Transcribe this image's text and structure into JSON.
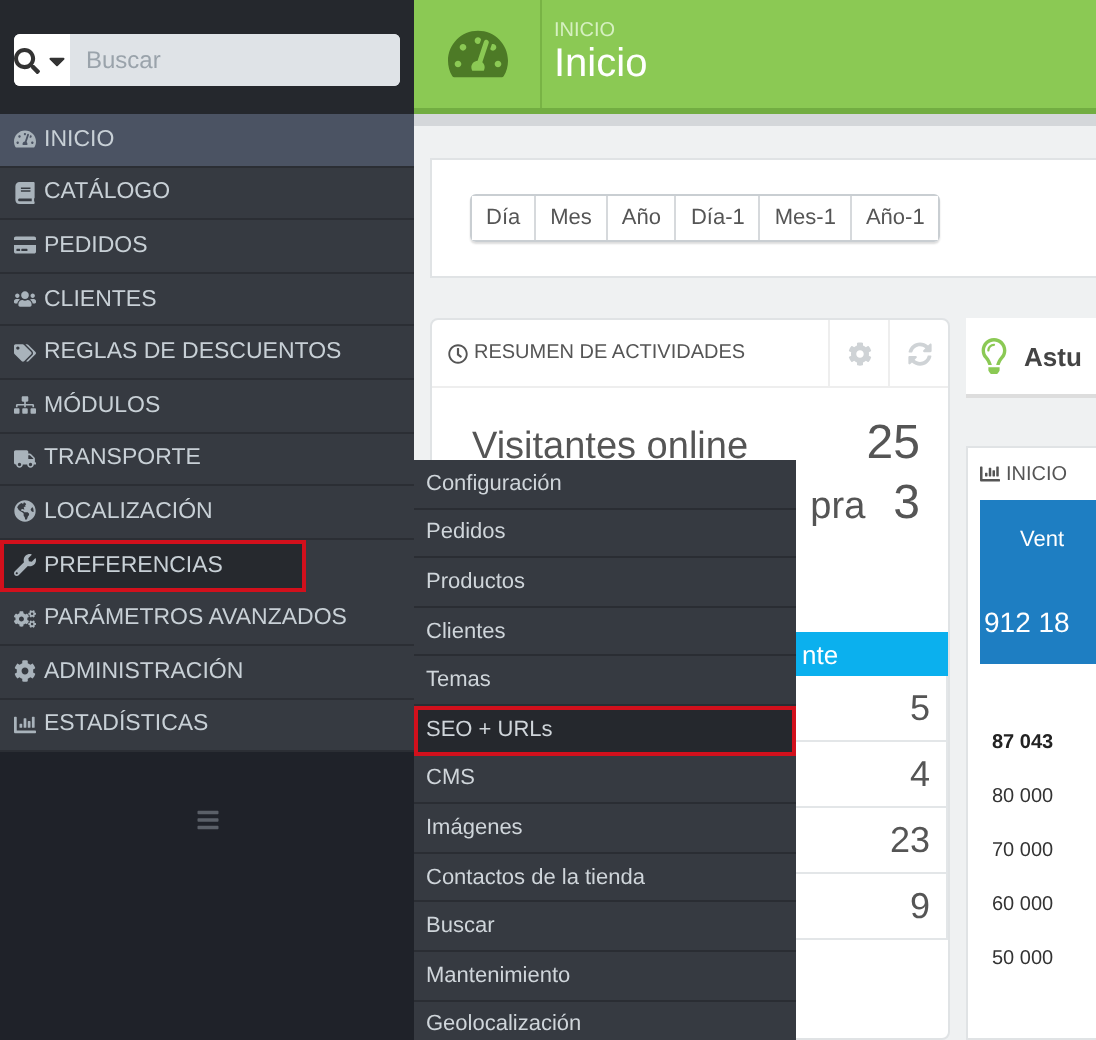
{
  "search": {
    "placeholder": "Buscar"
  },
  "sidebar": {
    "items": [
      {
        "label": "INICIO",
        "selected": true,
        "open": false,
        "highlighted": false
      },
      {
        "label": "CATÁLOGO",
        "selected": false,
        "open": false,
        "highlighted": false
      },
      {
        "label": "PEDIDOS",
        "selected": false,
        "open": false,
        "highlighted": false
      },
      {
        "label": "CLIENTES",
        "selected": false,
        "open": false,
        "highlighted": false
      },
      {
        "label": "REGLAS DE DESCUENTOS",
        "selected": false,
        "open": false,
        "highlighted": false
      },
      {
        "label": "MÓDULOS",
        "selected": false,
        "open": false,
        "highlighted": false
      },
      {
        "label": "TRANSPORTE",
        "selected": false,
        "open": false,
        "highlighted": false
      },
      {
        "label": "LOCALIZACIÓN",
        "selected": false,
        "open": false,
        "highlighted": false
      },
      {
        "label": "PREFERENCIAS",
        "selected": false,
        "open": true,
        "highlighted": true
      },
      {
        "label": "PARÁMETROS AVANZADOS",
        "selected": false,
        "open": false,
        "highlighted": false
      },
      {
        "label": "ADMINISTRACIÓN",
        "selected": false,
        "open": false,
        "highlighted": false
      },
      {
        "label": "ESTADÍSTICAS",
        "selected": false,
        "open": false,
        "highlighted": false
      }
    ]
  },
  "submenu": {
    "items": [
      {
        "label": "Configuración",
        "highlighted": false
      },
      {
        "label": "Pedidos",
        "highlighted": false
      },
      {
        "label": "Productos",
        "highlighted": false
      },
      {
        "label": "Clientes",
        "highlighted": false
      },
      {
        "label": "Temas",
        "highlighted": false
      },
      {
        "label": "SEO + URLs",
        "highlighted": true
      },
      {
        "label": "CMS",
        "highlighted": false
      },
      {
        "label": "Imágenes",
        "highlighted": false
      },
      {
        "label": "Contactos de la tienda",
        "highlighted": false
      },
      {
        "label": "Buscar",
        "highlighted": false
      },
      {
        "label": "Mantenimiento",
        "highlighted": false
      },
      {
        "label": "Geolocalización",
        "highlighted": false
      }
    ]
  },
  "header": {
    "breadcrumb": "INICIO",
    "title": "Inicio"
  },
  "date_buttons": [
    "Día",
    "Mes",
    "Año",
    "Día-1",
    "Mes-1",
    "Año-1"
  ],
  "activity": {
    "title": "RESUMEN DE ACTIVIDADES",
    "stats": [
      {
        "label": "Visitantes online",
        "value": "25"
      },
      {
        "label": "pra",
        "value": "3"
      }
    ],
    "table_header": "nte",
    "table_values": [
      "5",
      "4",
      "23",
      "9"
    ]
  },
  "tips": {
    "title": "Astu"
  },
  "dashboard": {
    "title": "INICIO",
    "kpi_label": "Vent",
    "kpi_value": "912 18",
    "chart_top": "87 043",
    "chart_ticks": [
      "80 000",
      "70 000",
      "60 000",
      "50 000"
    ]
  }
}
